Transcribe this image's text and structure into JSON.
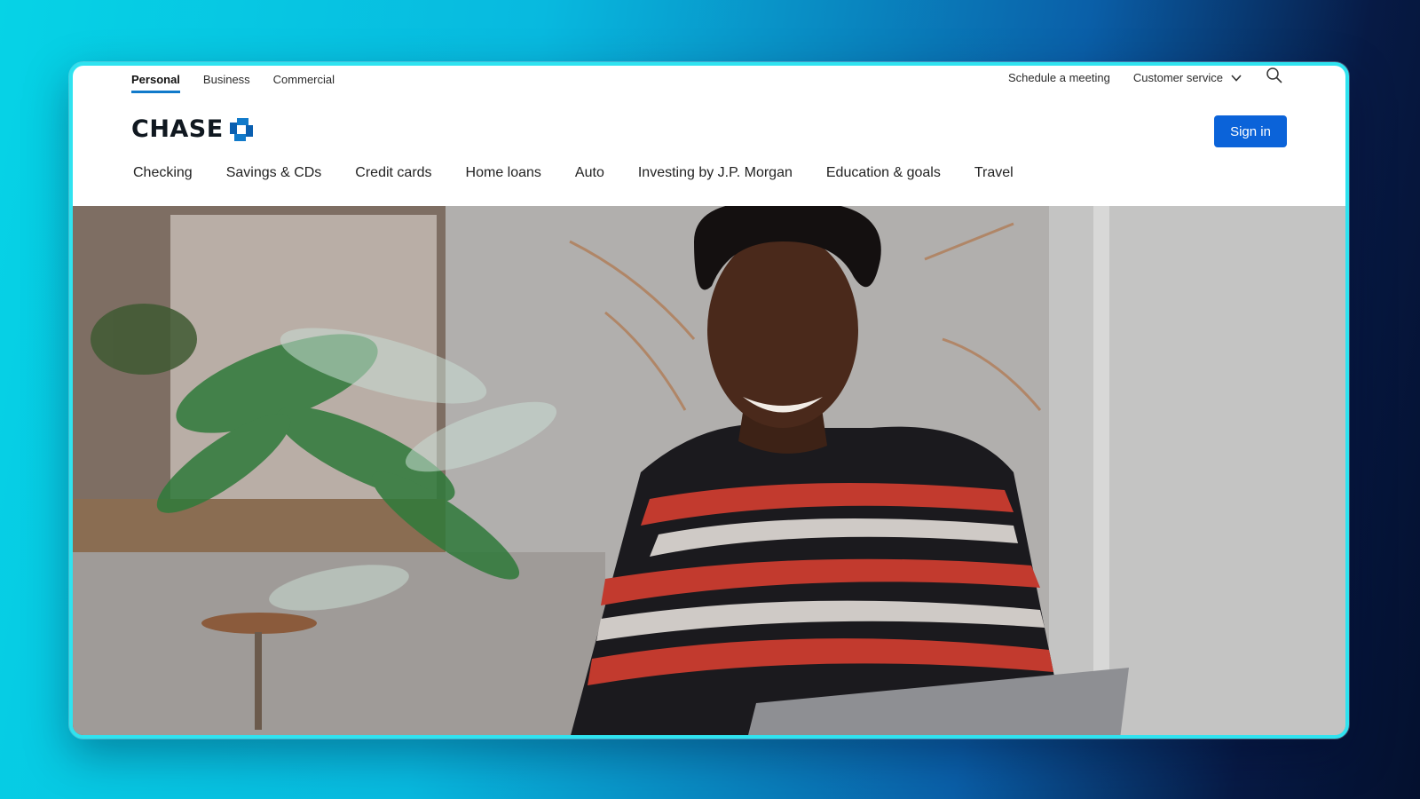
{
  "segment_tabs": [
    {
      "label": "Personal",
      "active": true
    },
    {
      "label": "Business",
      "active": false
    },
    {
      "label": "Commercial",
      "active": false
    }
  ],
  "utility": {
    "schedule_meeting": "Schedule a meeting",
    "customer_service": "Customer service",
    "search_icon": "search-icon",
    "chevron_icon": "chevron-down-icon"
  },
  "header": {
    "logo_text": "CHASE",
    "logo_icon": "chase-octagon-logo",
    "signin_label": "Sign in"
  },
  "main_nav": [
    {
      "label": "Checking"
    },
    {
      "label": "Savings & CDs"
    },
    {
      "label": "Credit cards"
    },
    {
      "label": "Home loans"
    },
    {
      "label": "Auto"
    },
    {
      "label": "Investing by J.P. Morgan"
    },
    {
      "label": "Education & goals"
    },
    {
      "label": "Travel"
    }
  ],
  "colors": {
    "brand_blue": "#117aca",
    "signin_blue": "#0b63d9",
    "window_border": "#2fe3f0"
  }
}
